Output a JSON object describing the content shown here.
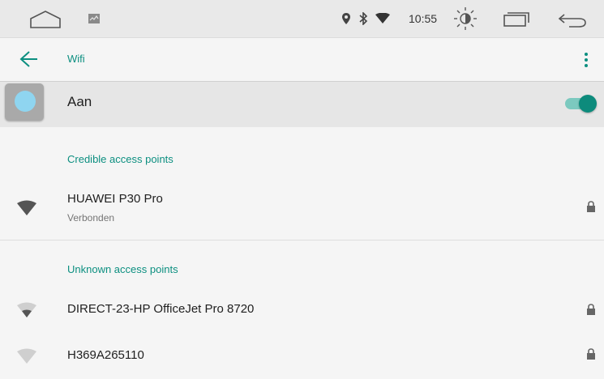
{
  "status_bar": {
    "time": "10:55",
    "icons": [
      "home-icon",
      "image-icon",
      "location-icon",
      "bluetooth-icon",
      "wifi-icon",
      "brightness-icon",
      "recent-apps-icon",
      "back-icon"
    ]
  },
  "app_bar": {
    "title": "Wifi",
    "back_icon": "arrow-back-icon",
    "menu_icon": "more-vert-icon"
  },
  "wifi_toggle": {
    "label": "Aan",
    "enabled": true
  },
  "sections": {
    "credible": {
      "title": "Credible access points",
      "networks": [
        {
          "name": "HUAWEI P30 Pro",
          "status": "Verbonden",
          "secured": true
        }
      ]
    },
    "unknown": {
      "title": "Unknown access points",
      "networks": [
        {
          "name": "DIRECT-23-HP OfficeJet Pro 8720",
          "secured": true
        },
        {
          "name": "H369A265110",
          "secured": true
        }
      ]
    }
  },
  "colors": {
    "accent": "#0c8f80",
    "switch_thumb": "#0d8b7c",
    "switch_track": "#7cc9bf"
  }
}
